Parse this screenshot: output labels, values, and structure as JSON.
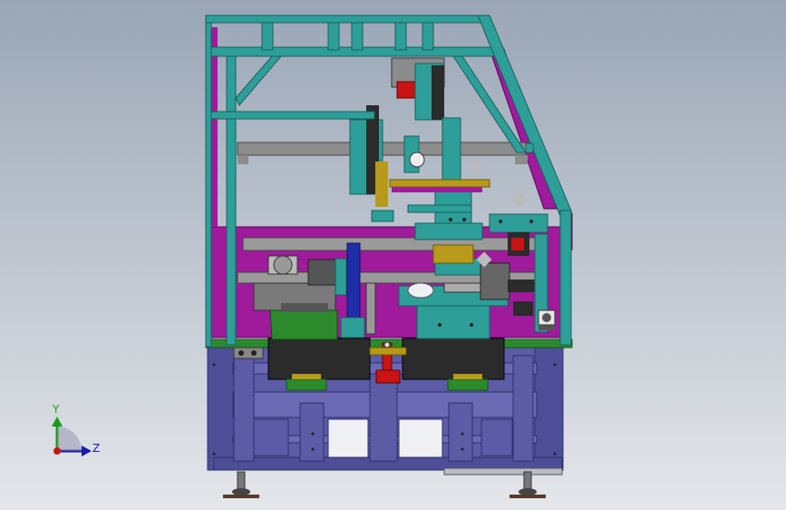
{
  "viewport": {
    "background_top": "#9aa6b6",
    "background_bottom": "#e4e6ea"
  },
  "colors": {
    "frame": "#2e9e98",
    "frame_dark": "#17605c",
    "panel": "#a01a9c",
    "base": "#5b5ba6",
    "base_dark": "#2f2f6a",
    "gray": "#8c8c8c",
    "green": "#2c8a2c",
    "red": "#c81414",
    "blue": "#1f2ea8",
    "dark": "#2a2a2a",
    "yellow": "#b89a1a"
  },
  "triad": {
    "y_label": "Y",
    "z_label": "Z",
    "y_color": "#1a9a1a",
    "z_color": "#1a1aa8",
    "x_color": "#c81414"
  }
}
